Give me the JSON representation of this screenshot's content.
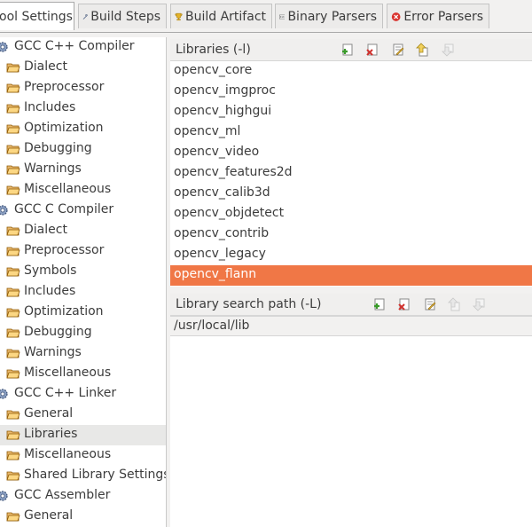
{
  "tabs": [
    {
      "label": "ool Settings",
      "icon": "none",
      "active": true
    },
    {
      "label": "Build Steps",
      "icon": "build-steps-icon",
      "active": false
    },
    {
      "label": "Build Artifact",
      "icon": "trophy-icon",
      "active": false
    },
    {
      "label": "Binary Parsers",
      "icon": "binary-icon",
      "active": false
    },
    {
      "label": "Error Parsers",
      "icon": "error-icon",
      "active": false
    }
  ],
  "tree": [
    {
      "label": "GCC C++ Compiler",
      "type": "category"
    },
    {
      "label": "Dialect",
      "type": "child"
    },
    {
      "label": "Preprocessor",
      "type": "child"
    },
    {
      "label": "Includes",
      "type": "child"
    },
    {
      "label": "Optimization",
      "type": "child"
    },
    {
      "label": "Debugging",
      "type": "child"
    },
    {
      "label": "Warnings",
      "type": "child"
    },
    {
      "label": "Miscellaneous",
      "type": "child"
    },
    {
      "label": "GCC C Compiler",
      "type": "category"
    },
    {
      "label": "Dialect",
      "type": "child"
    },
    {
      "label": "Preprocessor",
      "type": "child"
    },
    {
      "label": "Symbols",
      "type": "child"
    },
    {
      "label": "Includes",
      "type": "child"
    },
    {
      "label": "Optimization",
      "type": "child"
    },
    {
      "label": "Debugging",
      "type": "child"
    },
    {
      "label": "Warnings",
      "type": "child"
    },
    {
      "label": "Miscellaneous",
      "type": "child"
    },
    {
      "label": "GCC C++ Linker",
      "type": "category"
    },
    {
      "label": "General",
      "type": "child"
    },
    {
      "label": "Libraries",
      "type": "child",
      "selected": true
    },
    {
      "label": "Miscellaneous",
      "type": "child"
    },
    {
      "label": "Shared Library Settings",
      "type": "child"
    },
    {
      "label": "GCC Assembler",
      "type": "category"
    },
    {
      "label": "General",
      "type": "child"
    }
  ],
  "libraries": {
    "title": "Libraries (-l)",
    "items": [
      "opencv_core",
      "opencv_imgproc",
      "opencv_highgui",
      "opencv_ml",
      "opencv_video",
      "opencv_features2d",
      "opencv_calib3d",
      "opencv_objdetect",
      "opencv_contrib",
      "opencv_legacy",
      "opencv_flann"
    ],
    "selected_index": 10
  },
  "search_path": {
    "title": "Library search path (-L)",
    "items": [
      "/usr/local/lib"
    ]
  },
  "colors": {
    "selection": "#f07746",
    "tree_selection": "#e8e8e7"
  }
}
